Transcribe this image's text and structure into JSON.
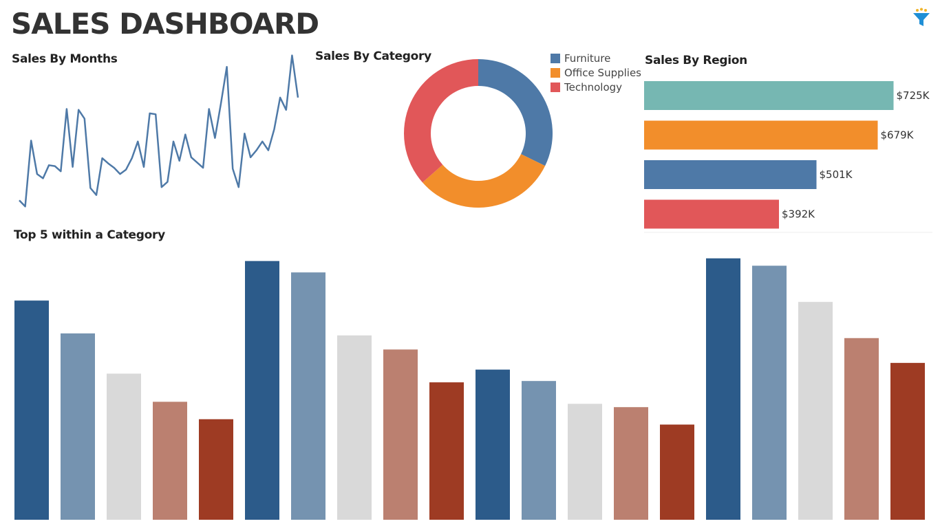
{
  "dashboard": {
    "title": "SALES DASHBOARD",
    "filter_icon": "filter-icon"
  },
  "colors": {
    "furniture": "#4e79a7",
    "office_supplies": "#f28e2b",
    "technology": "#e15759",
    "teal": "#76b7b2",
    "top5": [
      "#2c5b8a",
      "#7593b0",
      "#d9d9d9",
      "#bb8070",
      "#9e3b23"
    ]
  },
  "chart_data": [
    {
      "type": "line",
      "title": "Sales By Months",
      "xlabel": "",
      "ylabel": "",
      "x": [
        1,
        2,
        3,
        4,
        5,
        6,
        7,
        8,
        9,
        10,
        11,
        12,
        13,
        14,
        15,
        16,
        17,
        18,
        19,
        20,
        21,
        22,
        23,
        24,
        25,
        26,
        27,
        28,
        29,
        30,
        31,
        32,
        33,
        34,
        35,
        36,
        37,
        38,
        39,
        40,
        41,
        42,
        43,
        44,
        45,
        46,
        47,
        48,
        49
      ],
      "values": [
        13,
        6,
        81,
        43,
        38,
        53,
        52,
        46,
        117,
        51,
        116,
        106,
        27,
        19,
        61,
        55,
        50,
        43,
        48,
        61,
        80,
        51,
        112,
        111,
        28,
        34,
        80,
        58,
        88,
        62,
        56,
        50,
        117,
        84,
        123,
        165,
        49,
        28,
        89,
        62,
        70,
        80,
        70,
        94,
        130,
        116,
        178,
        130
      ],
      "grid": false
    },
    {
      "type": "pie",
      "title": "Sales By Category",
      "donut": true,
      "categories": [
        "Furniture",
        "Office Supplies",
        "Technology"
      ],
      "values": [
        32.2,
        31.3,
        36.5
      ],
      "legend": "top-right"
    },
    {
      "type": "bar",
      "orientation": "horizontal",
      "title": "Sales By Region",
      "categories": [
        "",
        "",
        "",
        ""
      ],
      "values": [
        725,
        679,
        501,
        392
      ],
      "labels": [
        "$725K",
        "$679K",
        "$501K",
        "$392K"
      ],
      "xlim": [
        0,
        760
      ]
    },
    {
      "type": "bar",
      "title": "Top 5 within a Category",
      "groups": 3,
      "values": [
        327,
        278,
        218,
        176,
        150,
        386,
        369,
        275,
        254,
        205,
        224,
        207,
        173,
        168,
        142,
        390,
        379,
        325,
        271,
        234
      ],
      "ylim": [
        0,
        400
      ]
    }
  ]
}
